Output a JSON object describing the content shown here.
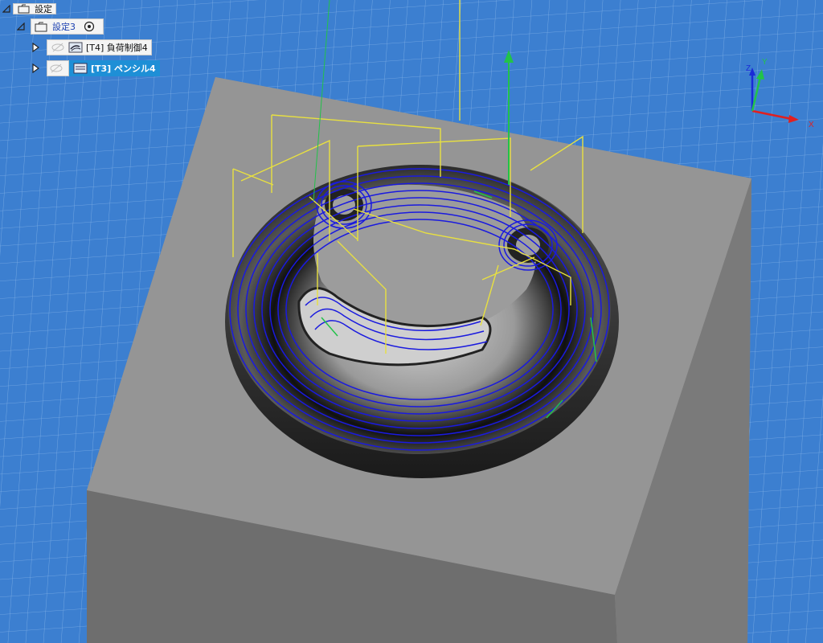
{
  "browser": {
    "root": {
      "label": "設定",
      "icon": "setup-folder-icon"
    },
    "setup": {
      "label": "設定3",
      "icon": "setup-folder-icon",
      "target_icon": "wcs-target-icon"
    },
    "operations": [
      {
        "label": "[T4] 負荷制御4",
        "icon": "adaptive-clearing-icon",
        "visibility_icon": "eye-hidden-icon",
        "selected": false
      },
      {
        "label": "[T3] ペンシル4",
        "icon": "pencil-toolpath-icon",
        "visibility_icon": "eye-hidden-icon",
        "selected": true
      }
    ]
  },
  "view": {
    "background": "#3c7fd0",
    "grid_color": "#8fb9ea",
    "stock_color": "#8a8a8a",
    "toolpath_color": "#1a1adf",
    "link_color": "#e8e040",
    "axis_triad": {
      "x_label": "X",
      "y_label": "Y",
      "z_label": "Z"
    }
  }
}
